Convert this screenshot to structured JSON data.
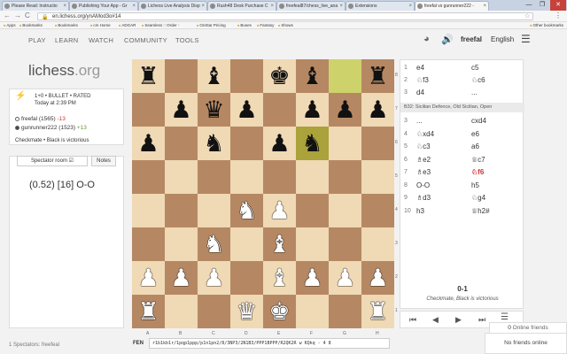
{
  "browser": {
    "tabs": [
      {
        "label": "Please Read: Instructio"
      },
      {
        "label": "Publishing Your App - Gr"
      },
      {
        "label": "Lichess Live Analysis Disp"
      },
      {
        "label": "Rush48 Desk Purchase C"
      },
      {
        "label": "freefeal87/chess_live_ana"
      },
      {
        "label": "Extensions"
      },
      {
        "label": "freefal vs gunrunner222 -"
      }
    ],
    "window_controls": [
      "—",
      "❐",
      "✕"
    ],
    "nav": {
      "back": "←",
      "forward": "→",
      "reload": "C"
    },
    "url": "en.lichess.org/ynAMod3o#14",
    "bookmarks": [
      "Apps",
      "Bookmarks",
      "Bookmarks",
      "cm Home",
      "ADGAR",
      "Seamless :: Order -",
      "OnStar Pricing",
      "Buses",
      "Fantasy",
      "Shows"
    ],
    "other_bookmarks": "Other bookmarks"
  },
  "site_nav": {
    "items": [
      "PLAY",
      "LEARN",
      "WATCH",
      "COMMUNITY",
      "TOOLS"
    ],
    "username": "freefal",
    "language": "English"
  },
  "logo": {
    "main": "lichess",
    "suffix": ".org"
  },
  "game": {
    "format": "1+0 • BULLET • RATED",
    "date": "Today at 2:39 PM",
    "white": {
      "name": "freefal (1565)",
      "diff": "-13"
    },
    "black": {
      "name": "gunrunner222 (1523)",
      "diff": "+13"
    },
    "result": "Checkmate • Black is victorious"
  },
  "side_tabs": {
    "spectator": "Spectator room",
    "notes": "Notes"
  },
  "evaluation": "(0.52) [16] O-O",
  "spectators": "1 Spectators: freefeal",
  "board": {
    "files": [
      "A",
      "B",
      "C",
      "D",
      "E",
      "F",
      "G",
      "H"
    ],
    "ranks": [
      "8",
      "7",
      "6",
      "5",
      "4",
      "3",
      "2",
      "1"
    ],
    "position": [
      [
        "r",
        "",
        "b",
        "",
        "k",
        "b",
        "",
        "r"
      ],
      [
        "",
        "p",
        "q",
        "p",
        "",
        "p",
        "p",
        "p"
      ],
      [
        "p",
        "",
        "n",
        "",
        "p",
        "n",
        "",
        ""
      ],
      [
        "",
        "",
        "",
        "",
        "",
        "",
        "",
        ""
      ],
      [
        "",
        "",
        "",
        "N",
        "P",
        "",
        "",
        ""
      ],
      [
        "",
        "",
        "N",
        "",
        "B",
        "",
        "",
        ""
      ],
      [
        "P",
        "P",
        "P",
        "",
        "B",
        "P",
        "P",
        "P"
      ],
      [
        "R",
        "",
        "",
        "Q",
        "K",
        "",
        "",
        "R"
      ]
    ],
    "highlight": [
      "f6",
      "g8"
    ]
  },
  "moves": {
    "before_opening": [
      {
        "no": "1",
        "white": "e4",
        "black": "c5"
      },
      {
        "no": "2",
        "white": "♘f3",
        "black": "♘c6"
      },
      {
        "no": "3",
        "white": "d4",
        "black": "..."
      }
    ],
    "opening": "B32: Sicilian Defence, Old Sicilian, Open",
    "after_opening": [
      {
        "no": "3",
        "white": "...",
        "black": "cxd4"
      },
      {
        "no": "4",
        "white": "♘xd4",
        "black": "e6"
      },
      {
        "no": "5",
        "white": "♘c3",
        "black": "a6"
      },
      {
        "no": "6",
        "white": "♗e2",
        "black": "♕c7"
      },
      {
        "no": "7",
        "white": "♗e3",
        "black": "♘f6"
      },
      {
        "no": "8",
        "white": "O-O",
        "black": "h5"
      },
      {
        "no": "9",
        "white": "♗d3",
        "black": "♘g4"
      },
      {
        "no": "10",
        "white": "h3",
        "black": "♕h2#"
      }
    ],
    "current_move": "♘f6",
    "score": "0-1",
    "score_desc": "Checkmate, Black is victorious"
  },
  "controls": {
    "first": "⏮",
    "prev": "◀",
    "next": "▶",
    "last": "⏭",
    "menu": "☰"
  },
  "friends": {
    "count": "0",
    "online_label": "Online friends",
    "empty": "No friends online"
  },
  "fen": {
    "label": "FEN",
    "value": "r1b1kb1r/1pqp1ppp/p1n1pn2/8/3NP3/2N1B3/PPP1BPPP/R2QK2R w KQkq - 4 8"
  }
}
